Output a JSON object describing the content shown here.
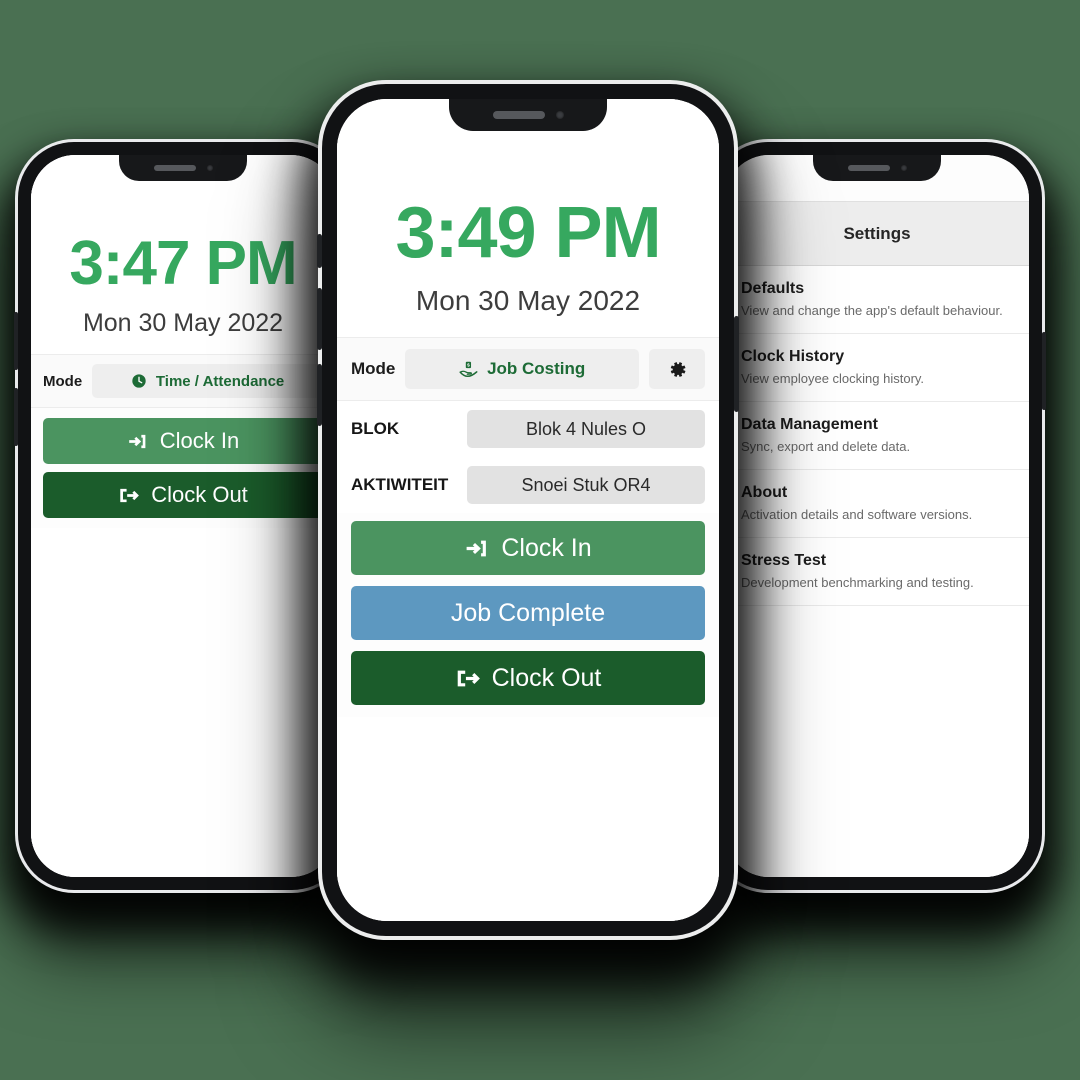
{
  "background_color": "#4a7052",
  "accent_colors": {
    "clock_green": "#36a85f",
    "clock_in_green": "#4b9460",
    "job_complete_blue": "#5d98c0",
    "clock_out_dark_green": "#1b5c2b",
    "mode_pill_grey": "#eeeeee",
    "field_value_grey": "#e2e2e2",
    "settings_header_grey": "#ededed"
  },
  "phone_left": {
    "name": "Time / Attendance screen",
    "clock": {
      "time": "3:47 PM",
      "date": "Mon 30 May 2022"
    },
    "mode": {
      "label": "Mode",
      "value": "Time / Attendance",
      "icon": "clock-icon"
    },
    "buttons": [
      {
        "label": "Clock In",
        "icon": "sign-in-icon",
        "style": "clock-in"
      },
      {
        "label": "Clock Out",
        "icon": "sign-out-icon",
        "style": "clock-out"
      }
    ]
  },
  "phone_center": {
    "name": "Job Costing screen",
    "clock": {
      "time": "3:49 PM",
      "date": "Mon 30 May 2022"
    },
    "mode": {
      "label": "Mode",
      "value": "Job Costing",
      "icon": "hand-holding-money-icon",
      "settings_icon": "gear-icon"
    },
    "fields": [
      {
        "label": "BLOK",
        "value": "Blok 4 Nules O"
      },
      {
        "label": "AKTIWITEIT",
        "value": "Snoei Stuk OR4"
      }
    ],
    "buttons": [
      {
        "label": "Clock In",
        "icon": "sign-in-icon",
        "style": "clock-in"
      },
      {
        "label": "Job Complete",
        "icon": "",
        "style": "job-complete"
      },
      {
        "label": "Clock Out",
        "icon": "sign-out-icon",
        "style": "clock-out"
      }
    ]
  },
  "phone_right": {
    "name": "Settings screen",
    "header": "Settings",
    "items": [
      {
        "title": "Defaults",
        "description": "View and change the app's default behaviour."
      },
      {
        "title": "Clock History",
        "description": "View employee clocking history."
      },
      {
        "title": "Data Management",
        "description": "Sync, export and delete data."
      },
      {
        "title": "About",
        "description": "Activation details and software versions."
      },
      {
        "title": "Stress Test",
        "description": "Development benchmarking and testing."
      }
    ]
  }
}
